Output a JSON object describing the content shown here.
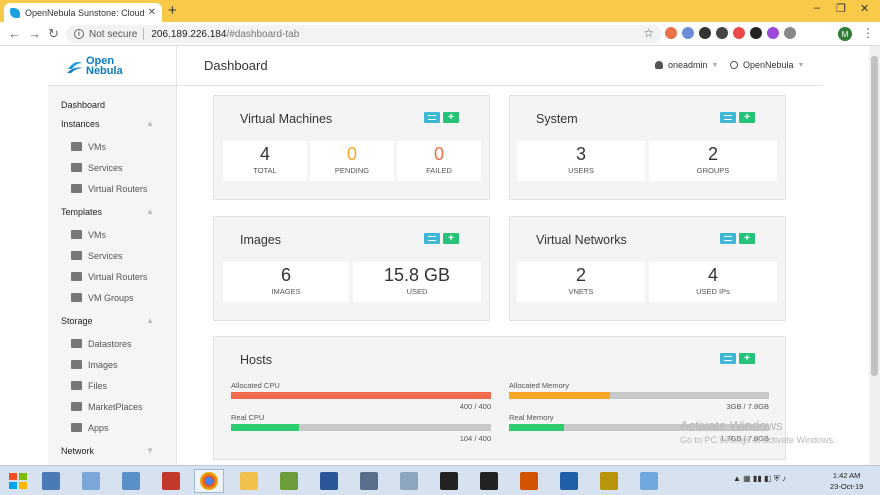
{
  "browser": {
    "tab_title": "OpenNebula Sunstone: Cloud Op",
    "tab_close": "✕",
    "new_tab": "+",
    "not_secure": "Not secure",
    "url_host": "206.189.226.184",
    "url_path": "/#dashboard-tab",
    "profile_initial": "M"
  },
  "logo": {
    "line1": "Open",
    "line2": "Nebula"
  },
  "sidebar": {
    "dashboard": "Dashboard",
    "groups": [
      {
        "label": "Instances",
        "items": [
          "VMs",
          "Services",
          "Virtual Routers"
        ]
      },
      {
        "label": "Templates",
        "items": [
          "VMs",
          "Services",
          "Virtual Routers",
          "VM Groups"
        ]
      },
      {
        "label": "Storage",
        "items": [
          "Datastores",
          "Images",
          "Files",
          "MarketPlaces",
          "Apps"
        ]
      },
      {
        "label": "Network",
        "items": []
      }
    ]
  },
  "header": {
    "title": "Dashboard",
    "user": "oneadmin",
    "zone": "OpenNebula"
  },
  "cards": {
    "vms": {
      "title": "Virtual Machines",
      "stats": [
        {
          "value": "4",
          "label": "TOTAL"
        },
        {
          "value": "0",
          "label": "PENDING"
        },
        {
          "value": "0",
          "label": "FAILED"
        }
      ]
    },
    "system": {
      "title": "System",
      "stats": [
        {
          "value": "3",
          "label": "USERS"
        },
        {
          "value": "2",
          "label": "GROUPS"
        }
      ]
    },
    "images": {
      "title": "Images",
      "stats": [
        {
          "value": "6",
          "label": "IMAGES"
        },
        {
          "value": "15.8 GB",
          "label": "USED"
        }
      ]
    },
    "vnets": {
      "title": "Virtual Networks",
      "stats": [
        {
          "value": "2",
          "label": "VNETS"
        },
        {
          "value": "4",
          "label": "USED IPs"
        }
      ]
    },
    "hosts": {
      "title": "Hosts",
      "bars": [
        {
          "label": "Allocated CPU",
          "value": "400 / 400",
          "fraction": 1.0,
          "color": "#f06a4b"
        },
        {
          "label": "Allocated Memory",
          "value": "3GB / 7.8GB",
          "fraction": 0.39,
          "color": "#f5a623"
        },
        {
          "label": "Real CPU",
          "value": "104 / 400",
          "fraction": 0.26,
          "color": "#2ecc71"
        },
        {
          "label": "Real Memory",
          "value": "1.7GB / 7.8GB",
          "fraction": 0.21,
          "color": "#2ecc71"
        }
      ]
    }
  },
  "watermark": {
    "line1": "Activate Windows",
    "line2": "Go to PC settings to activate Windows."
  },
  "taskbar": {
    "time": "1:42 AM",
    "date": "23-Oct-19"
  }
}
